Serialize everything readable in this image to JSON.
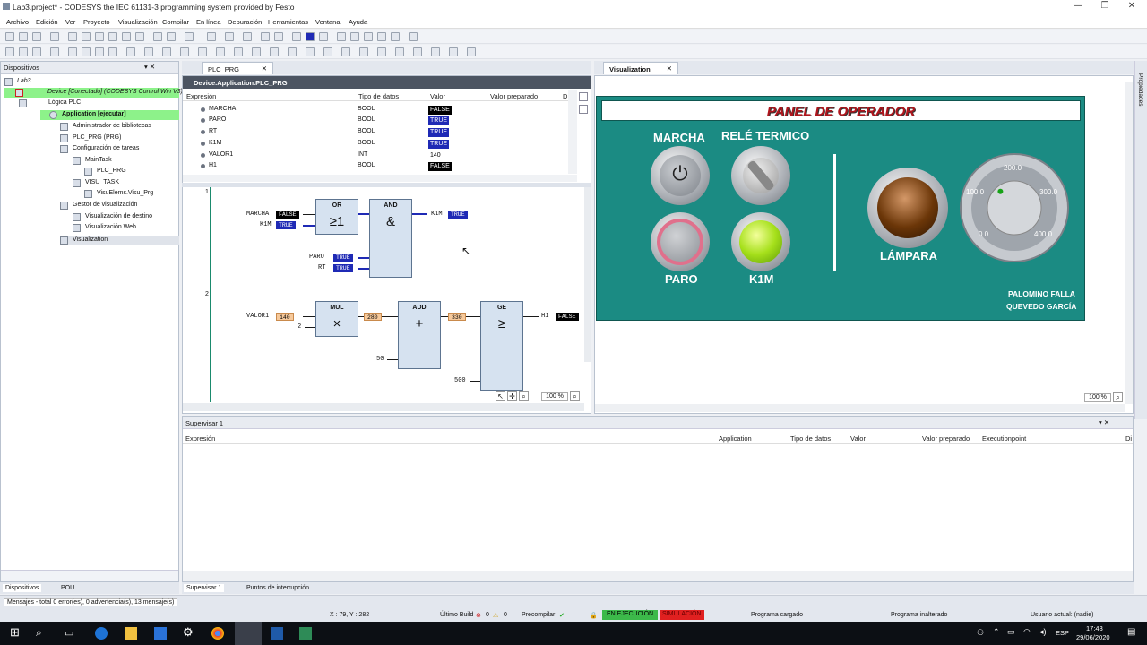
{
  "window": {
    "title": "Lab3.project* - CODESYS the IEC 61131-3 programming system provided by Festo"
  },
  "menu": [
    "Archivo",
    "Edición",
    "Ver",
    "Proyecto",
    "Visualización",
    "Compilar",
    "En línea",
    "Depuración",
    "Herramientas",
    "Ventana",
    "Ayuda"
  ],
  "devices": {
    "title": "Dispositivos",
    "items": [
      "Lab3",
      "Device [Conectado] (CODESYS Control Win V3)",
      "Lógica PLC",
      "Application [ejecutar]",
      "Administrador de bibliotecas",
      "PLC_PRG (PRG)",
      "Configuración de tareas",
      "MainTask",
      "PLC_PRG",
      "VISU_TASK",
      "VisuElems.Visu_Prg",
      "Gestor de visualización",
      "Visualización de destino",
      "Visualización Web",
      "Visualization"
    ],
    "bottom_tabs": [
      "Dispositivos",
      "POU"
    ]
  },
  "editor": {
    "tab": "PLC_PRG",
    "panel_title": "Device.Application.PLC_PRG",
    "columns": [
      "Expresión",
      "Tipo de datos",
      "Valor",
      "Valor preparado",
      "D"
    ],
    "rows": [
      {
        "name": "MARCHA",
        "type": "BOOL",
        "value": "FALSE"
      },
      {
        "name": "PARO",
        "type": "BOOL",
        "value": "TRUE"
      },
      {
        "name": "RT",
        "type": "BOOL",
        "value": "TRUE"
      },
      {
        "name": "K1M",
        "type": "BOOL",
        "value": "TRUE"
      },
      {
        "name": "VALOR1",
        "type": "INT",
        "value": "140"
      },
      {
        "name": "H1",
        "type": "BOOL",
        "value": "FALSE"
      }
    ],
    "network1": {
      "num": "1",
      "or_name": "OR",
      "or_sym": "≥1",
      "and_name": "AND",
      "and_sym": "&",
      "in_marcha": "MARCHA",
      "in_marcha_val": "FALSE",
      "in_k1m": "K1M",
      "in_k1m_val": "TRUE",
      "in_paro": "PARO",
      "in_paro_val": "TRUE",
      "in_rt": "RT",
      "in_rt_val": "TRUE",
      "out": "K1M",
      "out_val": "TRUE"
    },
    "network2": {
      "num": "2",
      "mul": "MUL",
      "mul_sym": "×",
      "add": "ADD",
      "add_sym": "+",
      "ge": "GE",
      "ge_sym": "≥",
      "in_valor": "VALOR1",
      "in_valor_val": "140",
      "const2": "2",
      "mul_out": "280",
      "const50": "50",
      "add_out": "330",
      "const500": "500",
      "out": "H1",
      "out_val": "FALSE"
    },
    "zoom": "100 %"
  },
  "visu": {
    "tab": "Visualization",
    "title": "PANEL DE OPERADOR",
    "marcha": "MARCHA",
    "rele": "RELÉ TERMICO",
    "paro": "PARO",
    "k1m": "K1M",
    "lampara": "LÁMPARA",
    "gauge_labels": [
      "0.0",
      "100.0",
      "200.0",
      "300.0",
      "400.0"
    ],
    "gauge_value": 140,
    "authors": [
      "PALOMINO FALLA",
      "QUEVEDO GARCÍA"
    ],
    "zoom": "100 %",
    "side_tab": "Propiedades"
  },
  "watch": {
    "title": "Supervisar 1",
    "columns": [
      "Expresión",
      "Application",
      "Tipo de datos",
      "Valor",
      "Valor preparado",
      "Executionpoint",
      "Di"
    ],
    "tabs": [
      "Supervisar 1",
      "Puntos de interrupción"
    ]
  },
  "messages": "Mensajes - total 0 error(es), 0 advertencia(s), 13 mensaje(s)",
  "status": {
    "coords": "X : 79, Y : 282",
    "build": "Último Build",
    "e": "0",
    "w": "0",
    "precompile": "Precompilar:",
    "running": "EN EJECUCIÓN",
    "sim": "SIMULACIÓN",
    "loaded": "Programa cargado",
    "unchanged": "Programa inalterado",
    "user": "Usuario actual: (nadie)"
  },
  "taskbar": {
    "lang": "ESP",
    "time": "17:43",
    "date": "29/06/2020"
  },
  "colors": {
    "visu_bg": "#1b8b83",
    "true": "#1f2ab5",
    "false": "#000000",
    "running": "#3cb94a",
    "sim": "#e02020"
  }
}
